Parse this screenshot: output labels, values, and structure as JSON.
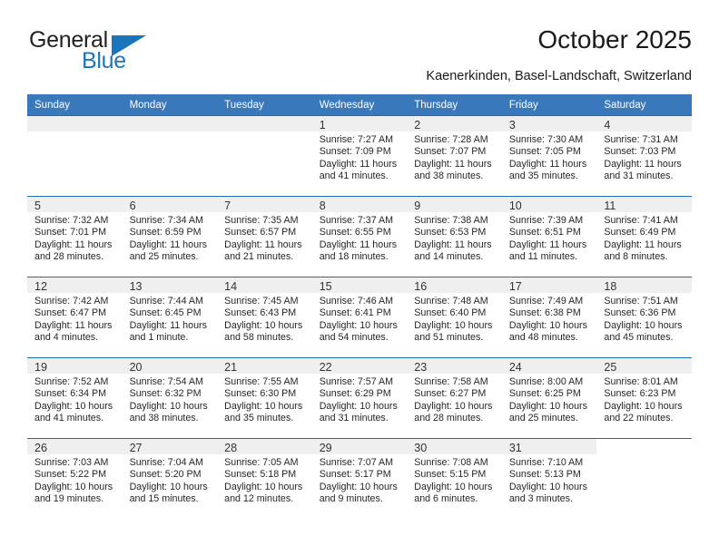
{
  "brand": {
    "name_part1": "General",
    "name_part2": "Blue",
    "logo_icon": "triangle-flag-icon",
    "accent_color": "#1b75bb"
  },
  "header": {
    "title": "October 2025",
    "location": "Kaenerkinden, Basel-Landschaft, Switzerland"
  },
  "colors": {
    "header_row_bg": "#3a78bc",
    "day_band_bg": "#efefef",
    "cell_border": "#1f6cb0",
    "text": "#262626"
  },
  "weekday_headers": [
    "Sunday",
    "Monday",
    "Tuesday",
    "Wednesday",
    "Thursday",
    "Friday",
    "Saturday"
  ],
  "weeks": [
    [
      {
        "day": "",
        "empty": true
      },
      {
        "day": "",
        "empty": true
      },
      {
        "day": "",
        "empty": true
      },
      {
        "day": "1",
        "sunrise": "Sunrise: 7:27 AM",
        "sunset": "Sunset: 7:09 PM",
        "daylight_line1": "Daylight: 11 hours",
        "daylight_line2": "and 41 minutes."
      },
      {
        "day": "2",
        "sunrise": "Sunrise: 7:28 AM",
        "sunset": "Sunset: 7:07 PM",
        "daylight_line1": "Daylight: 11 hours",
        "daylight_line2": "and 38 minutes."
      },
      {
        "day": "3",
        "sunrise": "Sunrise: 7:30 AM",
        "sunset": "Sunset: 7:05 PM",
        "daylight_line1": "Daylight: 11 hours",
        "daylight_line2": "and 35 minutes."
      },
      {
        "day": "4",
        "sunrise": "Sunrise: 7:31 AM",
        "sunset": "Sunset: 7:03 PM",
        "daylight_line1": "Daylight: 11 hours",
        "daylight_line2": "and 31 minutes."
      }
    ],
    [
      {
        "day": "5",
        "sunrise": "Sunrise: 7:32 AM",
        "sunset": "Sunset: 7:01 PM",
        "daylight_line1": "Daylight: 11 hours",
        "daylight_line2": "and 28 minutes."
      },
      {
        "day": "6",
        "sunrise": "Sunrise: 7:34 AM",
        "sunset": "Sunset: 6:59 PM",
        "daylight_line1": "Daylight: 11 hours",
        "daylight_line2": "and 25 minutes."
      },
      {
        "day": "7",
        "sunrise": "Sunrise: 7:35 AM",
        "sunset": "Sunset: 6:57 PM",
        "daylight_line1": "Daylight: 11 hours",
        "daylight_line2": "and 21 minutes."
      },
      {
        "day": "8",
        "sunrise": "Sunrise: 7:37 AM",
        "sunset": "Sunset: 6:55 PM",
        "daylight_line1": "Daylight: 11 hours",
        "daylight_line2": "and 18 minutes."
      },
      {
        "day": "9",
        "sunrise": "Sunrise: 7:38 AM",
        "sunset": "Sunset: 6:53 PM",
        "daylight_line1": "Daylight: 11 hours",
        "daylight_line2": "and 14 minutes."
      },
      {
        "day": "10",
        "sunrise": "Sunrise: 7:39 AM",
        "sunset": "Sunset: 6:51 PM",
        "daylight_line1": "Daylight: 11 hours",
        "daylight_line2": "and 11 minutes."
      },
      {
        "day": "11",
        "sunrise": "Sunrise: 7:41 AM",
        "sunset": "Sunset: 6:49 PM",
        "daylight_line1": "Daylight: 11 hours",
        "daylight_line2": "and 8 minutes."
      }
    ],
    [
      {
        "day": "12",
        "sunrise": "Sunrise: 7:42 AM",
        "sunset": "Sunset: 6:47 PM",
        "daylight_line1": "Daylight: 11 hours",
        "daylight_line2": "and 4 minutes."
      },
      {
        "day": "13",
        "sunrise": "Sunrise: 7:44 AM",
        "sunset": "Sunset: 6:45 PM",
        "daylight_line1": "Daylight: 11 hours",
        "daylight_line2": "and 1 minute."
      },
      {
        "day": "14",
        "sunrise": "Sunrise: 7:45 AM",
        "sunset": "Sunset: 6:43 PM",
        "daylight_line1": "Daylight: 10 hours",
        "daylight_line2": "and 58 minutes."
      },
      {
        "day": "15",
        "sunrise": "Sunrise: 7:46 AM",
        "sunset": "Sunset: 6:41 PM",
        "daylight_line1": "Daylight: 10 hours",
        "daylight_line2": "and 54 minutes."
      },
      {
        "day": "16",
        "sunrise": "Sunrise: 7:48 AM",
        "sunset": "Sunset: 6:40 PM",
        "daylight_line1": "Daylight: 10 hours",
        "daylight_line2": "and 51 minutes."
      },
      {
        "day": "17",
        "sunrise": "Sunrise: 7:49 AM",
        "sunset": "Sunset: 6:38 PM",
        "daylight_line1": "Daylight: 10 hours",
        "daylight_line2": "and 48 minutes."
      },
      {
        "day": "18",
        "sunrise": "Sunrise: 7:51 AM",
        "sunset": "Sunset: 6:36 PM",
        "daylight_line1": "Daylight: 10 hours",
        "daylight_line2": "and 45 minutes."
      }
    ],
    [
      {
        "day": "19",
        "sunrise": "Sunrise: 7:52 AM",
        "sunset": "Sunset: 6:34 PM",
        "daylight_line1": "Daylight: 10 hours",
        "daylight_line2": "and 41 minutes."
      },
      {
        "day": "20",
        "sunrise": "Sunrise: 7:54 AM",
        "sunset": "Sunset: 6:32 PM",
        "daylight_line1": "Daylight: 10 hours",
        "daylight_line2": "and 38 minutes."
      },
      {
        "day": "21",
        "sunrise": "Sunrise: 7:55 AM",
        "sunset": "Sunset: 6:30 PM",
        "daylight_line1": "Daylight: 10 hours",
        "daylight_line2": "and 35 minutes."
      },
      {
        "day": "22",
        "sunrise": "Sunrise: 7:57 AM",
        "sunset": "Sunset: 6:29 PM",
        "daylight_line1": "Daylight: 10 hours",
        "daylight_line2": "and 31 minutes."
      },
      {
        "day": "23",
        "sunrise": "Sunrise: 7:58 AM",
        "sunset": "Sunset: 6:27 PM",
        "daylight_line1": "Daylight: 10 hours",
        "daylight_line2": "and 28 minutes."
      },
      {
        "day": "24",
        "sunrise": "Sunrise: 8:00 AM",
        "sunset": "Sunset: 6:25 PM",
        "daylight_line1": "Daylight: 10 hours",
        "daylight_line2": "and 25 minutes."
      },
      {
        "day": "25",
        "sunrise": "Sunrise: 8:01 AM",
        "sunset": "Sunset: 6:23 PM",
        "daylight_line1": "Daylight: 10 hours",
        "daylight_line2": "and 22 minutes."
      }
    ],
    [
      {
        "day": "26",
        "sunrise": "Sunrise: 7:03 AM",
        "sunset": "Sunset: 5:22 PM",
        "daylight_line1": "Daylight: 10 hours",
        "daylight_line2": "and 19 minutes."
      },
      {
        "day": "27",
        "sunrise": "Sunrise: 7:04 AM",
        "sunset": "Sunset: 5:20 PM",
        "daylight_line1": "Daylight: 10 hours",
        "daylight_line2": "and 15 minutes."
      },
      {
        "day": "28",
        "sunrise": "Sunrise: 7:05 AM",
        "sunset": "Sunset: 5:18 PM",
        "daylight_line1": "Daylight: 10 hours",
        "daylight_line2": "and 12 minutes."
      },
      {
        "day": "29",
        "sunrise": "Sunrise: 7:07 AM",
        "sunset": "Sunset: 5:17 PM",
        "daylight_line1": "Daylight: 10 hours",
        "daylight_line2": "and 9 minutes."
      },
      {
        "day": "30",
        "sunrise": "Sunrise: 7:08 AM",
        "sunset": "Sunset: 5:15 PM",
        "daylight_line1": "Daylight: 10 hours",
        "daylight_line2": "and 6 minutes."
      },
      {
        "day": "31",
        "sunrise": "Sunrise: 7:10 AM",
        "sunset": "Sunset: 5:13 PM",
        "daylight_line1": "Daylight: 10 hours",
        "daylight_line2": "and 3 minutes."
      },
      {
        "day": "",
        "empty": true,
        "no_band": true
      }
    ]
  ]
}
